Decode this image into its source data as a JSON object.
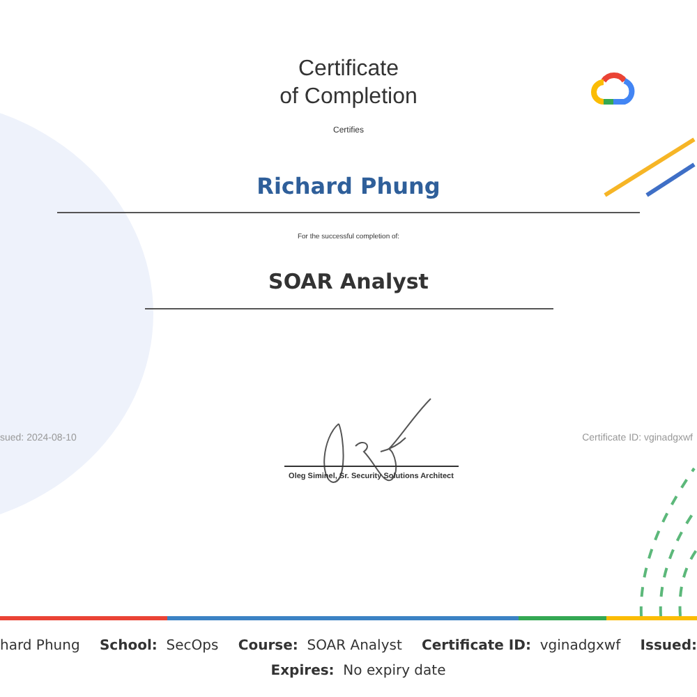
{
  "certificate": {
    "title_lines": [
      "Certificate",
      "of Completion"
    ],
    "certifies": "Certifies",
    "recipient": "Richard Phung",
    "completion_text": "For the successful completion of:",
    "course": "SOAR Analyst",
    "signer": "Oleg Siminel, Sr. Security Solutions Architect",
    "issued": "sued: 2024-08-10",
    "certificate_id": "Certificate ID: vginadgxwf"
  },
  "details": [
    {
      "value": "hard Phung"
    },
    {
      "label": "School:",
      "value": "SecOps"
    },
    {
      "label": "Course:",
      "value": "SOAR Analyst"
    },
    {
      "label": "Certificate ID:",
      "value": "vginadgxwf"
    },
    {
      "label": "Issued:"
    }
  ],
  "expires": {
    "label": "Expires:",
    "value": "No expiry date"
  }
}
